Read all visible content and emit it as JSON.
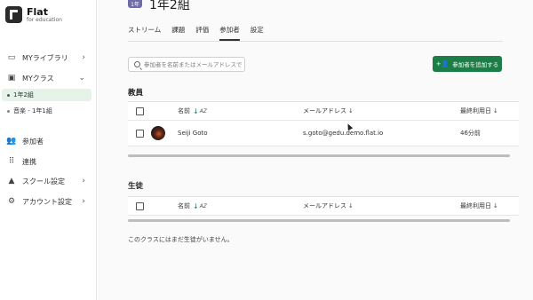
{
  "app": {
    "title": "Flat",
    "subtitle": "for education"
  },
  "sidebar": {
    "items": [
      {
        "label": "MYライブラリ",
        "icon": "folder-icon",
        "chevron": "›"
      },
      {
        "label": "MYクラス",
        "icon": "class-icon",
        "chevron": "⌄"
      },
      {
        "label": "参加者",
        "icon": "people-icon"
      },
      {
        "label": "連携",
        "icon": "apps-icon"
      },
      {
        "label": "スクール設定",
        "icon": "school-icon",
        "chevron": "›"
      },
      {
        "label": "アカウント設定",
        "icon": "gear-icon",
        "chevron": "›"
      }
    ],
    "classes": [
      {
        "label": "1年2組",
        "active": true
      },
      {
        "label": "音楽 - 1年1組",
        "active": false
      }
    ]
  },
  "header": {
    "class_title": "1年2組",
    "avatar_text": "1年"
  },
  "tabs": [
    {
      "label": "ストリーム"
    },
    {
      "label": "課題"
    },
    {
      "label": "評価"
    },
    {
      "label": "参加者",
      "active": true
    },
    {
      "label": "設定"
    }
  ],
  "search": {
    "placeholder": "参加者を名前またはメールアドレスで"
  },
  "add_button": {
    "label": "参加者を追加する",
    "icon": "add-person-icon",
    "color": "#1d7d47"
  },
  "teachers": {
    "title": "教員",
    "columns": {
      "name": "名前",
      "email": "メールアドレス",
      "last_used": "最終利用日"
    },
    "rows": [
      {
        "name": "Seiji Goto",
        "email": "s.goto@gedu.demo.flat.io",
        "last_used": "46分前"
      }
    ]
  },
  "students": {
    "title": "生徒",
    "columns": {
      "name": "名前",
      "email": "メールアドレス",
      "last_used": "最終利用日"
    },
    "empty_message": "このクラスにはまだ生徒がいません。"
  }
}
